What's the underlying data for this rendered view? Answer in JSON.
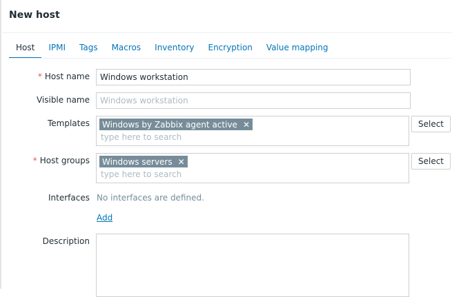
{
  "dialog": {
    "title": "New host"
  },
  "tabs": [
    {
      "label": "Host",
      "active": true
    },
    {
      "label": "IPMI"
    },
    {
      "label": "Tags"
    },
    {
      "label": "Macros"
    },
    {
      "label": "Inventory"
    },
    {
      "label": "Encryption"
    },
    {
      "label": "Value mapping"
    }
  ],
  "form": {
    "required_mark": "*",
    "host_name": {
      "label": "Host name",
      "value": "Windows workstation"
    },
    "visible_name": {
      "label": "Visible name",
      "value": "",
      "placeholder": "Windows workstation"
    },
    "templates": {
      "label": "Templates",
      "chip": "Windows by Zabbix agent active",
      "placeholder": "type here to search",
      "select_label": "Select"
    },
    "host_groups": {
      "label": "Host groups",
      "chip": "Windows servers",
      "placeholder": "type here to search",
      "select_label": "Select"
    },
    "interfaces": {
      "label": "Interfaces",
      "empty_text": "No interfaces are defined.",
      "add_label": "Add"
    },
    "description": {
      "label": "Description",
      "value": ""
    },
    "chip_remove_glyph": "✕"
  },
  "colors": {
    "accent": "#0275b8",
    "chip_bg": "#768d99",
    "required": "#e45959"
  }
}
